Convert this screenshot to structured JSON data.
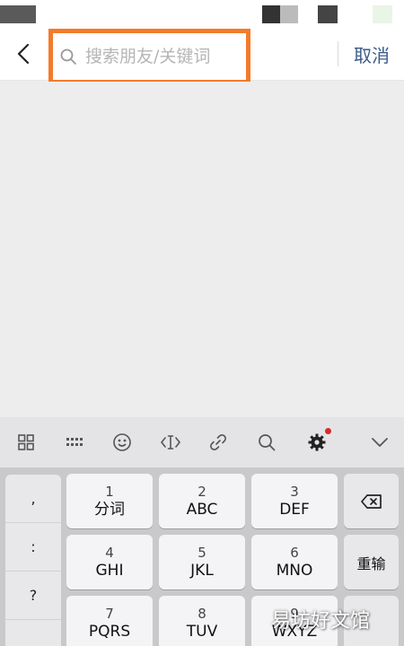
{
  "search": {
    "placeholder": "搜索朋友/关键词",
    "value": "",
    "highlight_color": "#f47b2a"
  },
  "header": {
    "cancel_label": "取消",
    "cancel_color": "#3b5b8a"
  },
  "keyboard": {
    "toolbar_icons": [
      "grid-icon",
      "keyboard-icon",
      "emoji-icon",
      "cursor-icon",
      "link-icon",
      "search-icon",
      "settings-icon",
      "collapse-icon"
    ],
    "punctuation": [
      ",",
      ":",
      "?",
      "。"
    ],
    "keys": [
      {
        "num": "1",
        "label": "分词"
      },
      {
        "num": "2",
        "label": "ABC"
      },
      {
        "num": "3",
        "label": "DEF"
      },
      {
        "num": "4",
        "label": "GHI"
      },
      {
        "num": "5",
        "label": "JKL"
      },
      {
        "num": "6",
        "label": "MNO"
      },
      {
        "num": "7",
        "label": "PQRS"
      },
      {
        "num": "8",
        "label": "TUV"
      },
      {
        "num": "9",
        "label": "WXYZ"
      }
    ],
    "delete_icon": "backspace-icon",
    "reenter_label": "重输"
  },
  "watermark": "易坊好文馆"
}
